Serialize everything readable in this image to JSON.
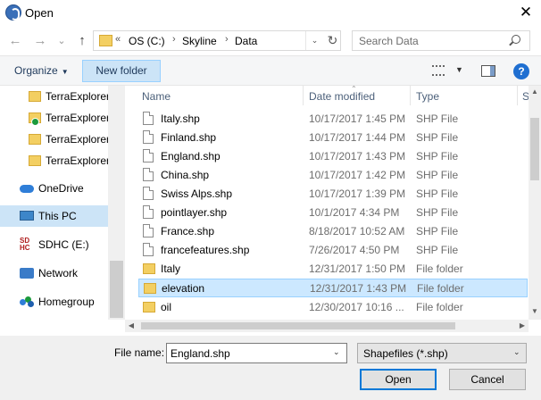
{
  "window": {
    "title": "Open",
    "close_symbol": "✕"
  },
  "nav": {
    "back": "←",
    "forward": "→",
    "recent": "⌄",
    "up": "↑"
  },
  "address": {
    "prefix": "«",
    "crumbs": [
      "OS (C:)",
      "Skyline",
      "Data"
    ],
    "separator": "›",
    "dropdown": "⌄",
    "refresh": "↻"
  },
  "search": {
    "placeholder": "Search Data"
  },
  "toolbar": {
    "organize_label": "Organize",
    "organize_caret": "▼",
    "new_folder_label": "New folder",
    "view_caret": "▼",
    "help_label": "?"
  },
  "sidebar": {
    "items": [
      {
        "label": "TerraExplorer",
        "icon": "folder-icon"
      },
      {
        "label": "TerraExplorer",
        "icon": "folder-synced-icon"
      },
      {
        "label": "TerraExplorer",
        "icon": "folder-icon"
      },
      {
        "label": "TerraExplorer",
        "icon": "folder-icon"
      },
      {
        "label": "OneDrive",
        "icon": "cloud-icon"
      },
      {
        "label": "This PC",
        "icon": "computer-icon",
        "selected": true
      },
      {
        "label": "SDHC (E:)",
        "icon": "sd-card-icon",
        "icon_text": "SD\nHC"
      },
      {
        "label": "Network",
        "icon": "network-icon"
      },
      {
        "label": "Homegroup",
        "icon": "homegroup-icon"
      }
    ]
  },
  "files": {
    "columns": [
      "Name",
      "Date modified",
      "Type",
      "S"
    ],
    "rows": [
      {
        "name": "Italy.shp",
        "date": "10/17/2017 1:45 PM",
        "type": "SHP File",
        "kind": "file"
      },
      {
        "name": "Finland.shp",
        "date": "10/17/2017 1:44 PM",
        "type": "SHP File",
        "kind": "file"
      },
      {
        "name": "England.shp",
        "date": "10/17/2017 1:43 PM",
        "type": "SHP File",
        "kind": "file"
      },
      {
        "name": "China.shp",
        "date": "10/17/2017 1:42 PM",
        "type": "SHP File",
        "kind": "file"
      },
      {
        "name": "Swiss Alps.shp",
        "date": "10/17/2017 1:39 PM",
        "type": "SHP File",
        "kind": "file"
      },
      {
        "name": "pointlayer.shp",
        "date": "10/1/2017 4:34 PM",
        "type": "SHP File",
        "kind": "file"
      },
      {
        "name": "France.shp",
        "date": "8/18/2017 10:52 AM",
        "type": "SHP File",
        "kind": "file"
      },
      {
        "name": "francefeatures.shp",
        "date": "7/26/2017 4:50 PM",
        "type": "SHP File",
        "kind": "file"
      },
      {
        "name": "Italy",
        "date": "12/31/2017 1:50 PM",
        "type": "File folder",
        "kind": "folder"
      },
      {
        "name": "elevation",
        "date": "12/31/2017 1:43 PM",
        "type": "File folder",
        "kind": "folder",
        "selected": true
      },
      {
        "name": "oil",
        "date": "12/30/2017 10:16 ...",
        "type": "File folder",
        "kind": "folder"
      }
    ]
  },
  "scroll": {
    "up": "▲",
    "down": "▼",
    "left": "◀",
    "right": "▶"
  },
  "bottom": {
    "file_name_label": "File name:",
    "file_name_value": "England.shp",
    "file_name_caret": "⌄",
    "filter_value": "Shapefiles (*.shp)",
    "filter_caret": "⌄",
    "open_label": "Open",
    "cancel_label": "Cancel"
  }
}
